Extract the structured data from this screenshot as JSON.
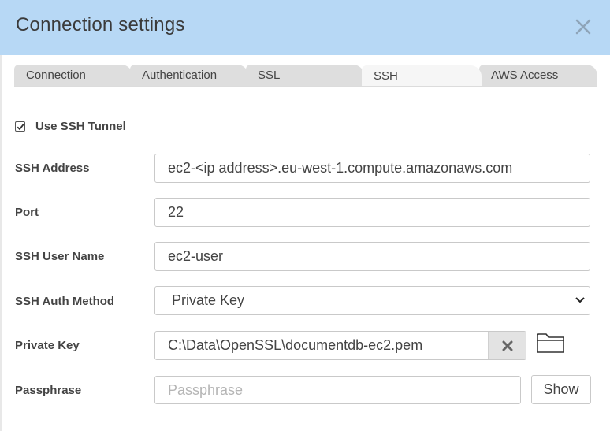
{
  "dialog": {
    "title": "Connection settings",
    "close_icon": "close-icon"
  },
  "tabs": [
    {
      "label": "Connection",
      "active": false
    },
    {
      "label": "Authentication",
      "active": false
    },
    {
      "label": "SSL",
      "active": false
    },
    {
      "label": "SSH",
      "active": true
    },
    {
      "label": "AWS Access",
      "active": false
    }
  ],
  "ssh": {
    "use_tunnel_label": "Use SSH Tunnel",
    "use_tunnel_checked": true,
    "address_label": "SSH Address",
    "address_value": "ec2-<ip address>.eu-west-1.compute.amazonaws.com",
    "port_label": "Port",
    "port_value": "22",
    "user_label": "SSH User Name",
    "user_value": "ec2-user",
    "auth_label": "SSH Auth Method",
    "auth_value": "Private Key",
    "key_label": "Private Key",
    "key_value": "C:\\Data\\OpenSSL\\documentdb-ec2.pem",
    "passphrase_label": "Passphrase",
    "passphrase_placeholder": "Passphrase",
    "show_label": "Show"
  },
  "colors": {
    "titlebar": "#b7d8f5",
    "tab_inactive": "#dedede",
    "tab_active": "#f6f6f6"
  }
}
